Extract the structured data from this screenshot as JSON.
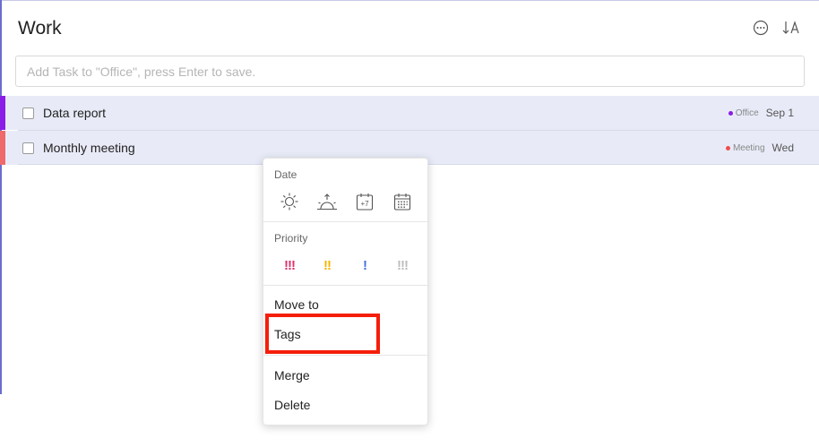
{
  "header": {
    "title": "Work"
  },
  "add_task": {
    "placeholder": "Add Task to \"Office\", press Enter to save."
  },
  "tasks": [
    {
      "title": "Data report",
      "tag": "Office",
      "date": "Sep 1",
      "bar_color": "#8b1de6",
      "tag_color": "#8b1de6"
    },
    {
      "title": "Monthly meeting",
      "tag": "Meeting",
      "date": "Wed",
      "bar_color": "#ef6a6a",
      "tag_color": "#ef4d4d"
    }
  ],
  "context_menu": {
    "date_label": "Date",
    "date_icons": [
      "sun-icon",
      "sunset-icon",
      "plus-seven-days-icon",
      "calendar-icon"
    ],
    "plus7_text": "+7",
    "priority_label": "Priority",
    "priorities": [
      {
        "glyph": "!!!",
        "color": "#e0326e"
      },
      {
        "glyph": "!!",
        "color": "#f5b500"
      },
      {
        "glyph": "!",
        "color": "#4672e0"
      },
      {
        "glyph": "!!!",
        "color": "#bdbdbd"
      }
    ],
    "items": {
      "move_to": "Move to",
      "tags": "Tags",
      "merge": "Merge",
      "delete": "Delete"
    }
  },
  "colors": {
    "highlight": "#f51e0a",
    "row_bg": "#e8ebf7"
  }
}
